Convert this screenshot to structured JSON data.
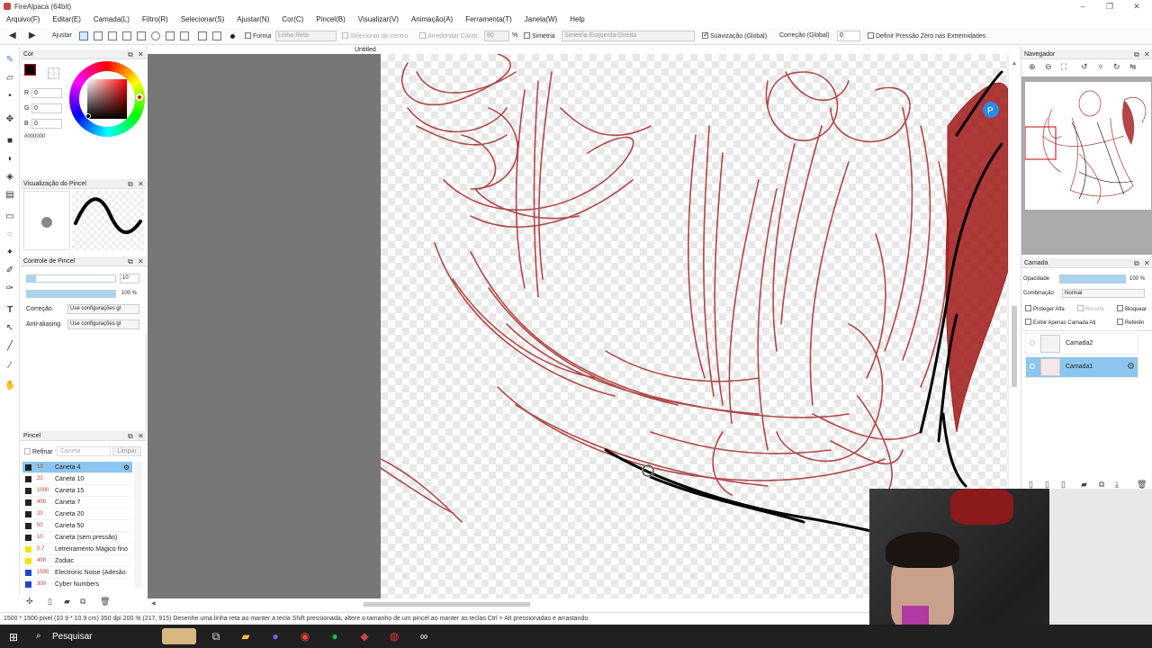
{
  "window": {
    "title": "FireAlpaca (64bit)"
  },
  "menu": [
    "Arquivo(F)",
    "Editar(E)",
    "Camada(L)",
    "Filtro(R)",
    "Selecionar(S)",
    "Ajustar(N)",
    "Cor(C)",
    "Pincel(B)",
    "Visualizar(V)",
    "Animação(A)",
    "Ferramenta(T)",
    "Janela(W)",
    "Help"
  ],
  "toolbar": {
    "ajustar": "Ajustar",
    "forma": "Forma",
    "forma_value": "Linha Reta",
    "selecionar_centro": "Selecionar do centro",
    "arredondar_canto": "Arredondar Canto",
    "arredondar_value": "80",
    "percent": "%",
    "simetria": "Simetria",
    "simetria_value": "Simetria Esquerda-Direita",
    "suavizacao": "Suavização (Global)",
    "correcao_label": "Correção (Global)",
    "correcao_value": "0",
    "pressao": "Definir Pressão Zero nas Extremidades"
  },
  "document_tab": "Untitled",
  "color_panel": {
    "title": "Cor",
    "r_label": "R",
    "g_label": "G",
    "b_label": "B",
    "r": "0",
    "g": "0",
    "b": "0",
    "hex": "#000000",
    "accent": "#cc0000"
  },
  "brush_preview": {
    "title": "Visualização do Pincel"
  },
  "brush_control": {
    "title": "Controle de Pincel",
    "size": "10",
    "opacity": "100 %",
    "correcao_label": "Correção",
    "correcao_value": "Use configurações gl",
    "antialias_label": "Anti-aliasing",
    "antialias_value": "Use configurações gl"
  },
  "brush_panel": {
    "title": "Pincel",
    "refinar": "Refinar",
    "caneta": "Caneta",
    "limpar": "Limpar",
    "items": [
      {
        "size": "10",
        "name": "Caneta 4",
        "color": "#222222"
      },
      {
        "size": "20",
        "name": "Caneta 10",
        "color": "#222222"
      },
      {
        "size": "1000",
        "name": "Caneta 15",
        "color": "#222222"
      },
      {
        "size": "400",
        "name": "Caneta 7",
        "color": "#222222"
      },
      {
        "size": "20",
        "name": "Caneta 20",
        "color": "#222222"
      },
      {
        "size": "50",
        "name": "Caneta 50",
        "color": "#222222"
      },
      {
        "size": "10",
        "name": "Caneta (sem pressão)",
        "color": "#222222"
      },
      {
        "size": "0.7",
        "name": "Letreiramento Mágico fino",
        "color": "#f2e400"
      },
      {
        "size": "400",
        "name": "Zodiac",
        "color": "#f2e400"
      },
      {
        "size": "1500",
        "name": "Electronic Noise (Adesão",
        "color": "#2244cc"
      },
      {
        "size": "300",
        "name": "Cyber Numbers",
        "color": "#2244cc"
      }
    ]
  },
  "navigator": {
    "title": "Navegador"
  },
  "layer_panel": {
    "title": "Camada",
    "opacidade_label": "Opacidade",
    "opacidade_value": "100 %",
    "combinacao_label": "Combinação",
    "combinacao_value": "Normal",
    "proteger_alfa": "Proteger Alfa",
    "recorte": "Recorte",
    "bloquear": "Bloquear",
    "exibir_apenas": "Exibir Apenas Camada Ati",
    "referencia": "Referên",
    "layers": [
      {
        "name": "Camada2"
      },
      {
        "name": "Camada1"
      }
    ]
  },
  "status": "1500 * 1500 pixel  (10.9 * 10.9 cm)  350 dpi  200 %  (217, 915)  Desenhe uma linha reta ao manter a tecla Shift pressionada, altere o tamanho de um pincel ao manter as teclas Ctrl + Alt pressionadas e arrastando",
  "taskbar": {
    "search": "Pesquisar"
  }
}
